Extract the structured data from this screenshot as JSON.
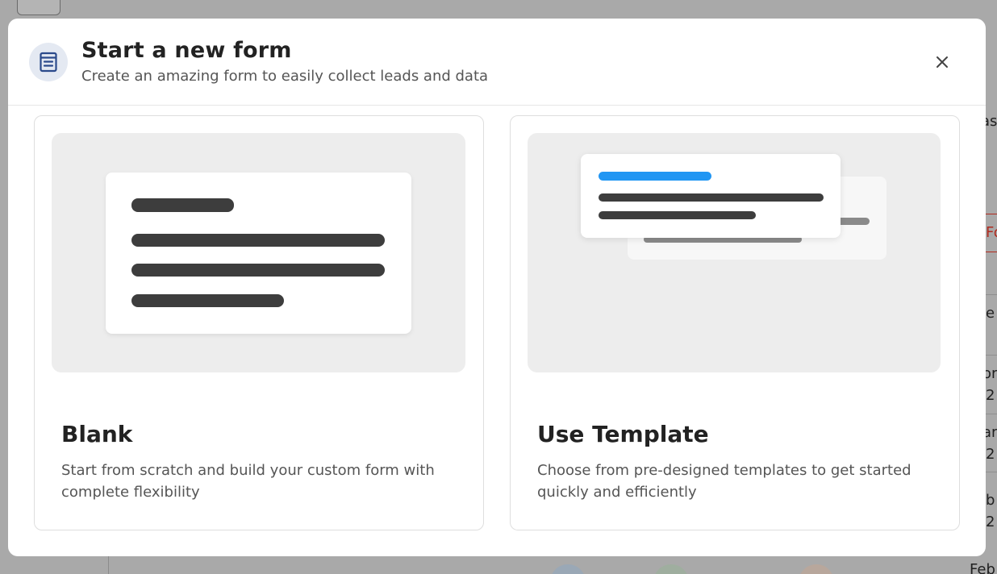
{
  "modal": {
    "title": "Start a new form",
    "subtitle": "Create an amazing form to easily collect leads and data",
    "header_icon": "form-icon",
    "close_icon": "close-icon"
  },
  "options": [
    {
      "title": "Blank",
      "description": "Start from scratch and build your custom form with complete flexibility"
    },
    {
      "title": "Use Template",
      "description": "Choose from pre-designed templates to get started quickly and efficiently"
    }
  ],
  "background_fragments": [
    "as",
    "Fo",
    "e",
    "or",
    "2",
    "ar",
    "2",
    "b",
    "2",
    "Feb"
  ],
  "colors": {
    "accent": "#2196f3",
    "overlay": "#a9a9a9",
    "icon_bg": "#e4e9f2",
    "icon_fg": "#2b4a8b",
    "error_red": "#b02a1e"
  }
}
